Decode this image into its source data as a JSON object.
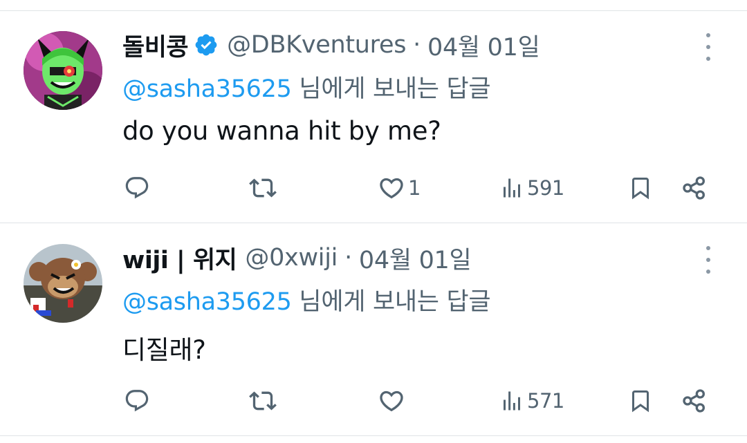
{
  "tweets": [
    {
      "display_name": "돌비콩",
      "verified": true,
      "handle": "@DBKventures",
      "separator": "·",
      "date": "04월 01일",
      "reply_mention": "@sasha35625",
      "reply_suffix": " 님에게 보내는 답글",
      "text": "do you wanna hit by me?",
      "likes": "1",
      "views": "591"
    },
    {
      "display_name": "wiji | 위지",
      "verified": false,
      "handle": "@0xwiji",
      "separator": "·",
      "date": "04월 01일",
      "reply_mention": "@sasha35625",
      "reply_suffix": " 님에게 보내는 답글",
      "text": "디질래?",
      "likes": "",
      "views": "571"
    }
  ],
  "colors": {
    "accent": "#1d9bf0",
    "secondary_text": "#536471",
    "primary_text": "#0f1419",
    "divider": "#dfe3e6"
  },
  "icons": [
    "reply-icon",
    "retweet-icon",
    "like-icon",
    "views-icon",
    "bookmark-icon",
    "share-icon",
    "more-icon",
    "verified-badge-icon"
  ]
}
